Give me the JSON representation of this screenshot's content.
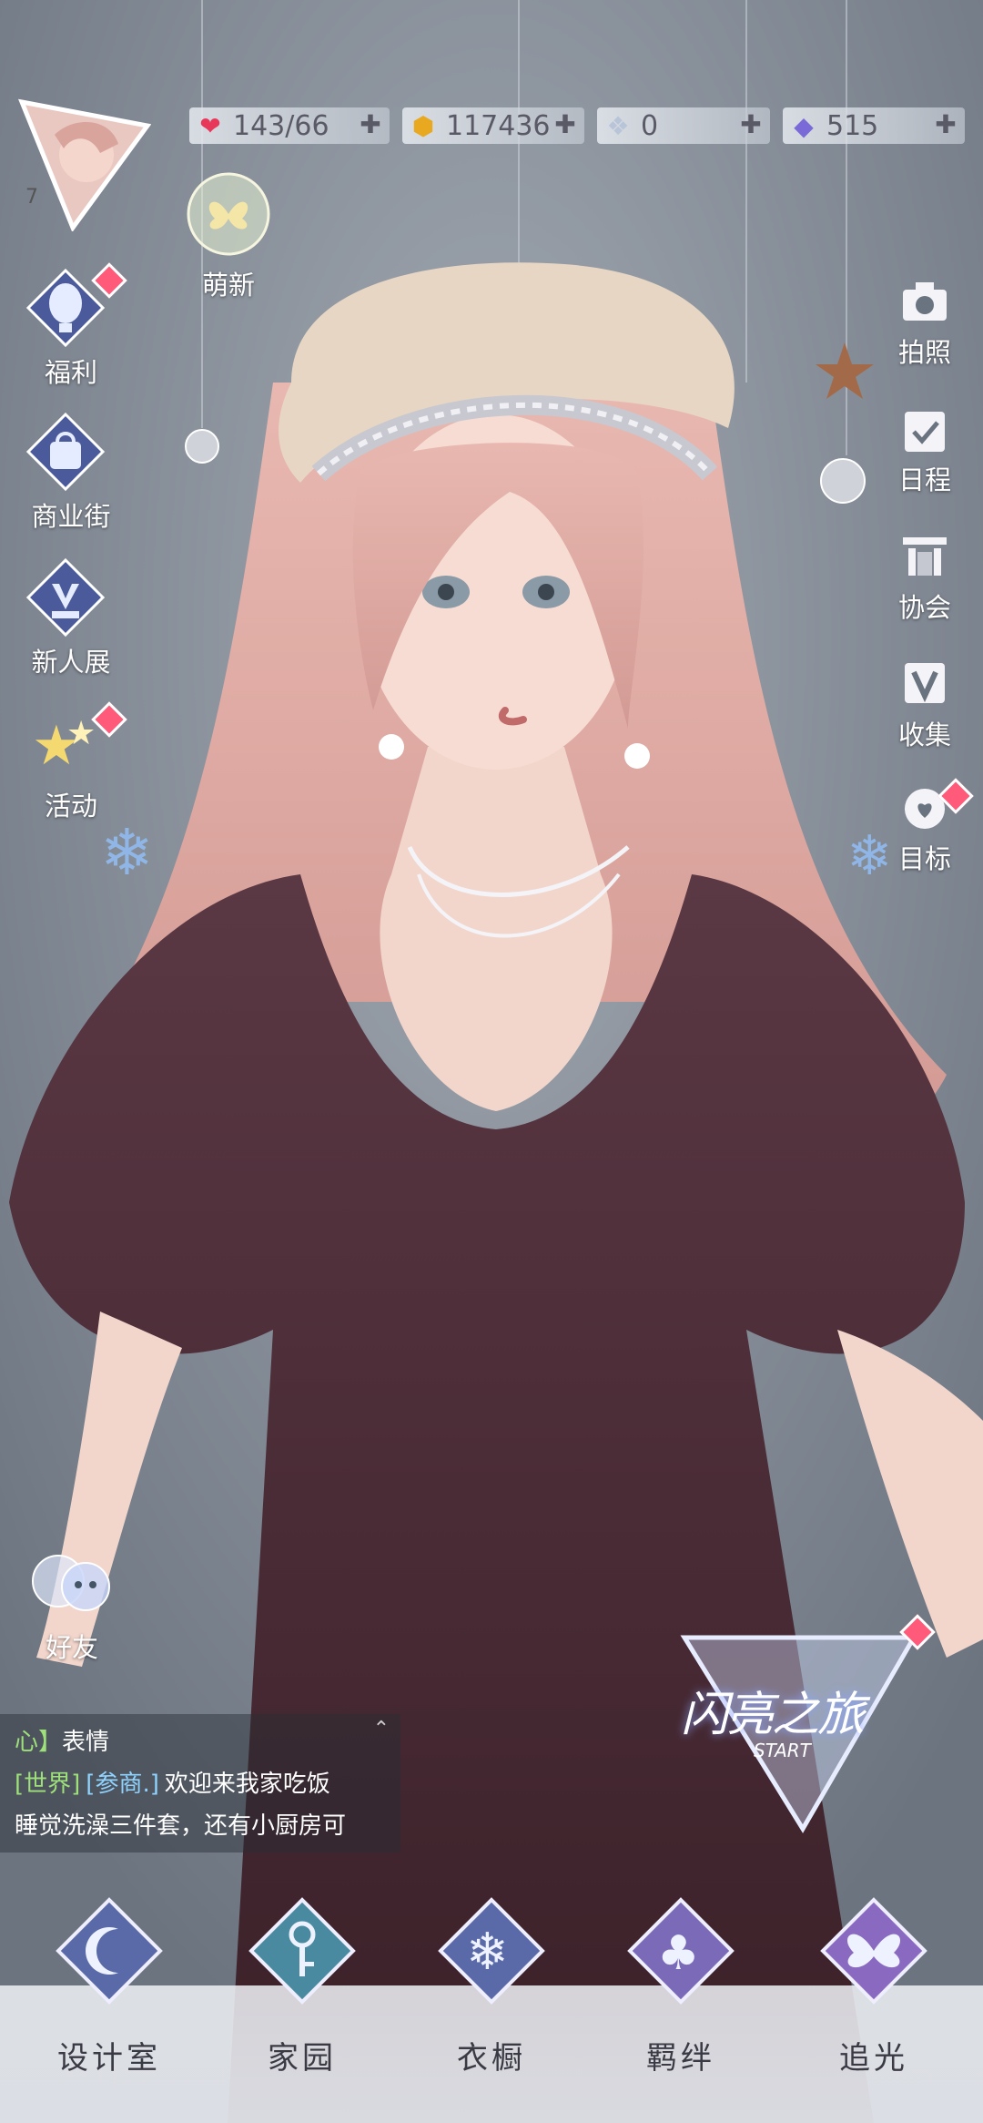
{
  "player": {
    "level": "7"
  },
  "currencies": [
    {
      "name": "stamina",
      "icon": "heart-icon",
      "value": "143/66",
      "color": "#e8385a"
    },
    {
      "name": "gold",
      "icon": "gold-coin-icon",
      "value": "117436",
      "color": "#e8a820"
    },
    {
      "name": "crystal",
      "icon": "crystal-icon",
      "value": "0",
      "color": "#b8c4d8"
    },
    {
      "name": "diamond",
      "icon": "diamond-icon",
      "value": "515",
      "color": "#7a6ad8"
    }
  ],
  "badge": {
    "label": "萌新"
  },
  "left_menu": [
    {
      "key": "welfare",
      "label": "福利",
      "icon": "hot-air-balloon-icon",
      "dot": true
    },
    {
      "key": "shop",
      "label": "商业街",
      "icon": "shopping-bag-icon",
      "dot": false
    },
    {
      "key": "newbie",
      "label": "新人展",
      "icon": "trophy-icon",
      "dot": false
    },
    {
      "key": "event",
      "label": "活动",
      "icon": "stars-icon",
      "dot": true
    }
  ],
  "right_menu": [
    {
      "key": "photo",
      "label": "拍照",
      "icon": "camera-icon"
    },
    {
      "key": "schedule",
      "label": "日程",
      "icon": "calendar-icon"
    },
    {
      "key": "guild",
      "label": "协会",
      "icon": "guild-hall-icon"
    },
    {
      "key": "collect",
      "label": "收集",
      "icon": "v-collection-icon"
    },
    {
      "key": "goal",
      "label": "目标",
      "icon": "target-medal-icon",
      "dot": true
    }
  ],
  "friends": {
    "label": "好友"
  },
  "event_banner": {
    "title": "闪亮之旅",
    "sub": "START"
  },
  "chat": {
    "lines": [
      {
        "prefix": "心】",
        "text": "表情",
        "prefix_color": "#9ee07a",
        "color": "#ffffff"
      },
      {
        "prefix": "[世界]",
        "name": "[参商.]",
        "text": "欢迎来我家吃饭",
        "prefix_color": "#9ee07a",
        "name_color": "#8fd3ff",
        "color": "#ffffff"
      },
      {
        "text": "睡觉洗澡三件套，还有小厨房可",
        "color": "#ffffff"
      }
    ]
  },
  "bottom_nav": [
    {
      "key": "design",
      "label": "设计室",
      "icon": "moon-key-icon"
    },
    {
      "key": "home",
      "label": "家园",
      "icon": "key-gem-icon"
    },
    {
      "key": "wardrobe",
      "label": "衣橱",
      "icon": "snowflake-gem-icon"
    },
    {
      "key": "bond",
      "label": "羁绊",
      "icon": "clover-gem-icon"
    },
    {
      "key": "chase",
      "label": "追光",
      "icon": "butterfly-gem-icon"
    }
  ]
}
